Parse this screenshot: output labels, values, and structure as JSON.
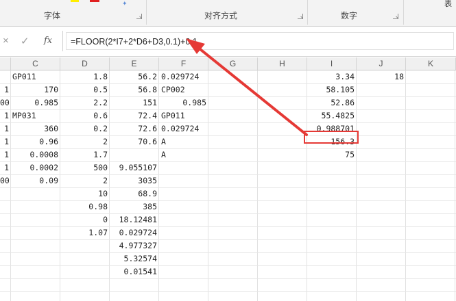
{
  "ribbon": {
    "groups": [
      {
        "label": "字体"
      },
      {
        "label": "对齐方式"
      },
      {
        "label": "数字"
      }
    ],
    "right_label": "表"
  },
  "formula_bar": {
    "cancel_symbol": "×",
    "enter_symbol": "✓",
    "fx_label": "fx",
    "formula": "=FLOOR(2*I7+2*D6+D3,0.1)+0.1"
  },
  "columns": [
    "C",
    "D",
    "E",
    "F",
    "G",
    "H",
    "I",
    "J",
    "K"
  ],
  "cells": {
    "B": [
      "",
      "1",
      "00",
      "1",
      "1",
      "1",
      "1",
      "1",
      "00"
    ],
    "C": [
      "GP011",
      "170",
      "0.985",
      "MP031",
      "360",
      "0.96",
      "0.0008",
      "0.0002",
      "0.09"
    ],
    "D": [
      "1.8",
      "0.5",
      "2.2",
      "0.6",
      "0.2",
      "2",
      "1.7",
      "500",
      "2",
      "10",
      "0.98",
      "0",
      "1.07"
    ],
    "E": [
      "56.2",
      "56.8",
      "151",
      "72.4",
      "72.6",
      "70.6",
      "",
      "9.055107",
      "3035",
      "68.9",
      "385",
      "18.12481",
      "0.029724",
      "4.977327",
      "5.32574",
      "0.01541"
    ],
    "F": [
      "0.029724",
      "CP002",
      "0.985",
      "GP011",
      "0.029724",
      "A",
      "A"
    ],
    "I": [
      "3.34",
      "58.105",
      "52.86",
      "55.4825",
      "0.988701",
      "156.3",
      "75"
    ],
    "J": [
      "18"
    ]
  },
  "selected_cell": {
    "value": "156.3"
  },
  "colors": {
    "highlight": "#e53935",
    "header_bg": "#f0f0f0"
  }
}
